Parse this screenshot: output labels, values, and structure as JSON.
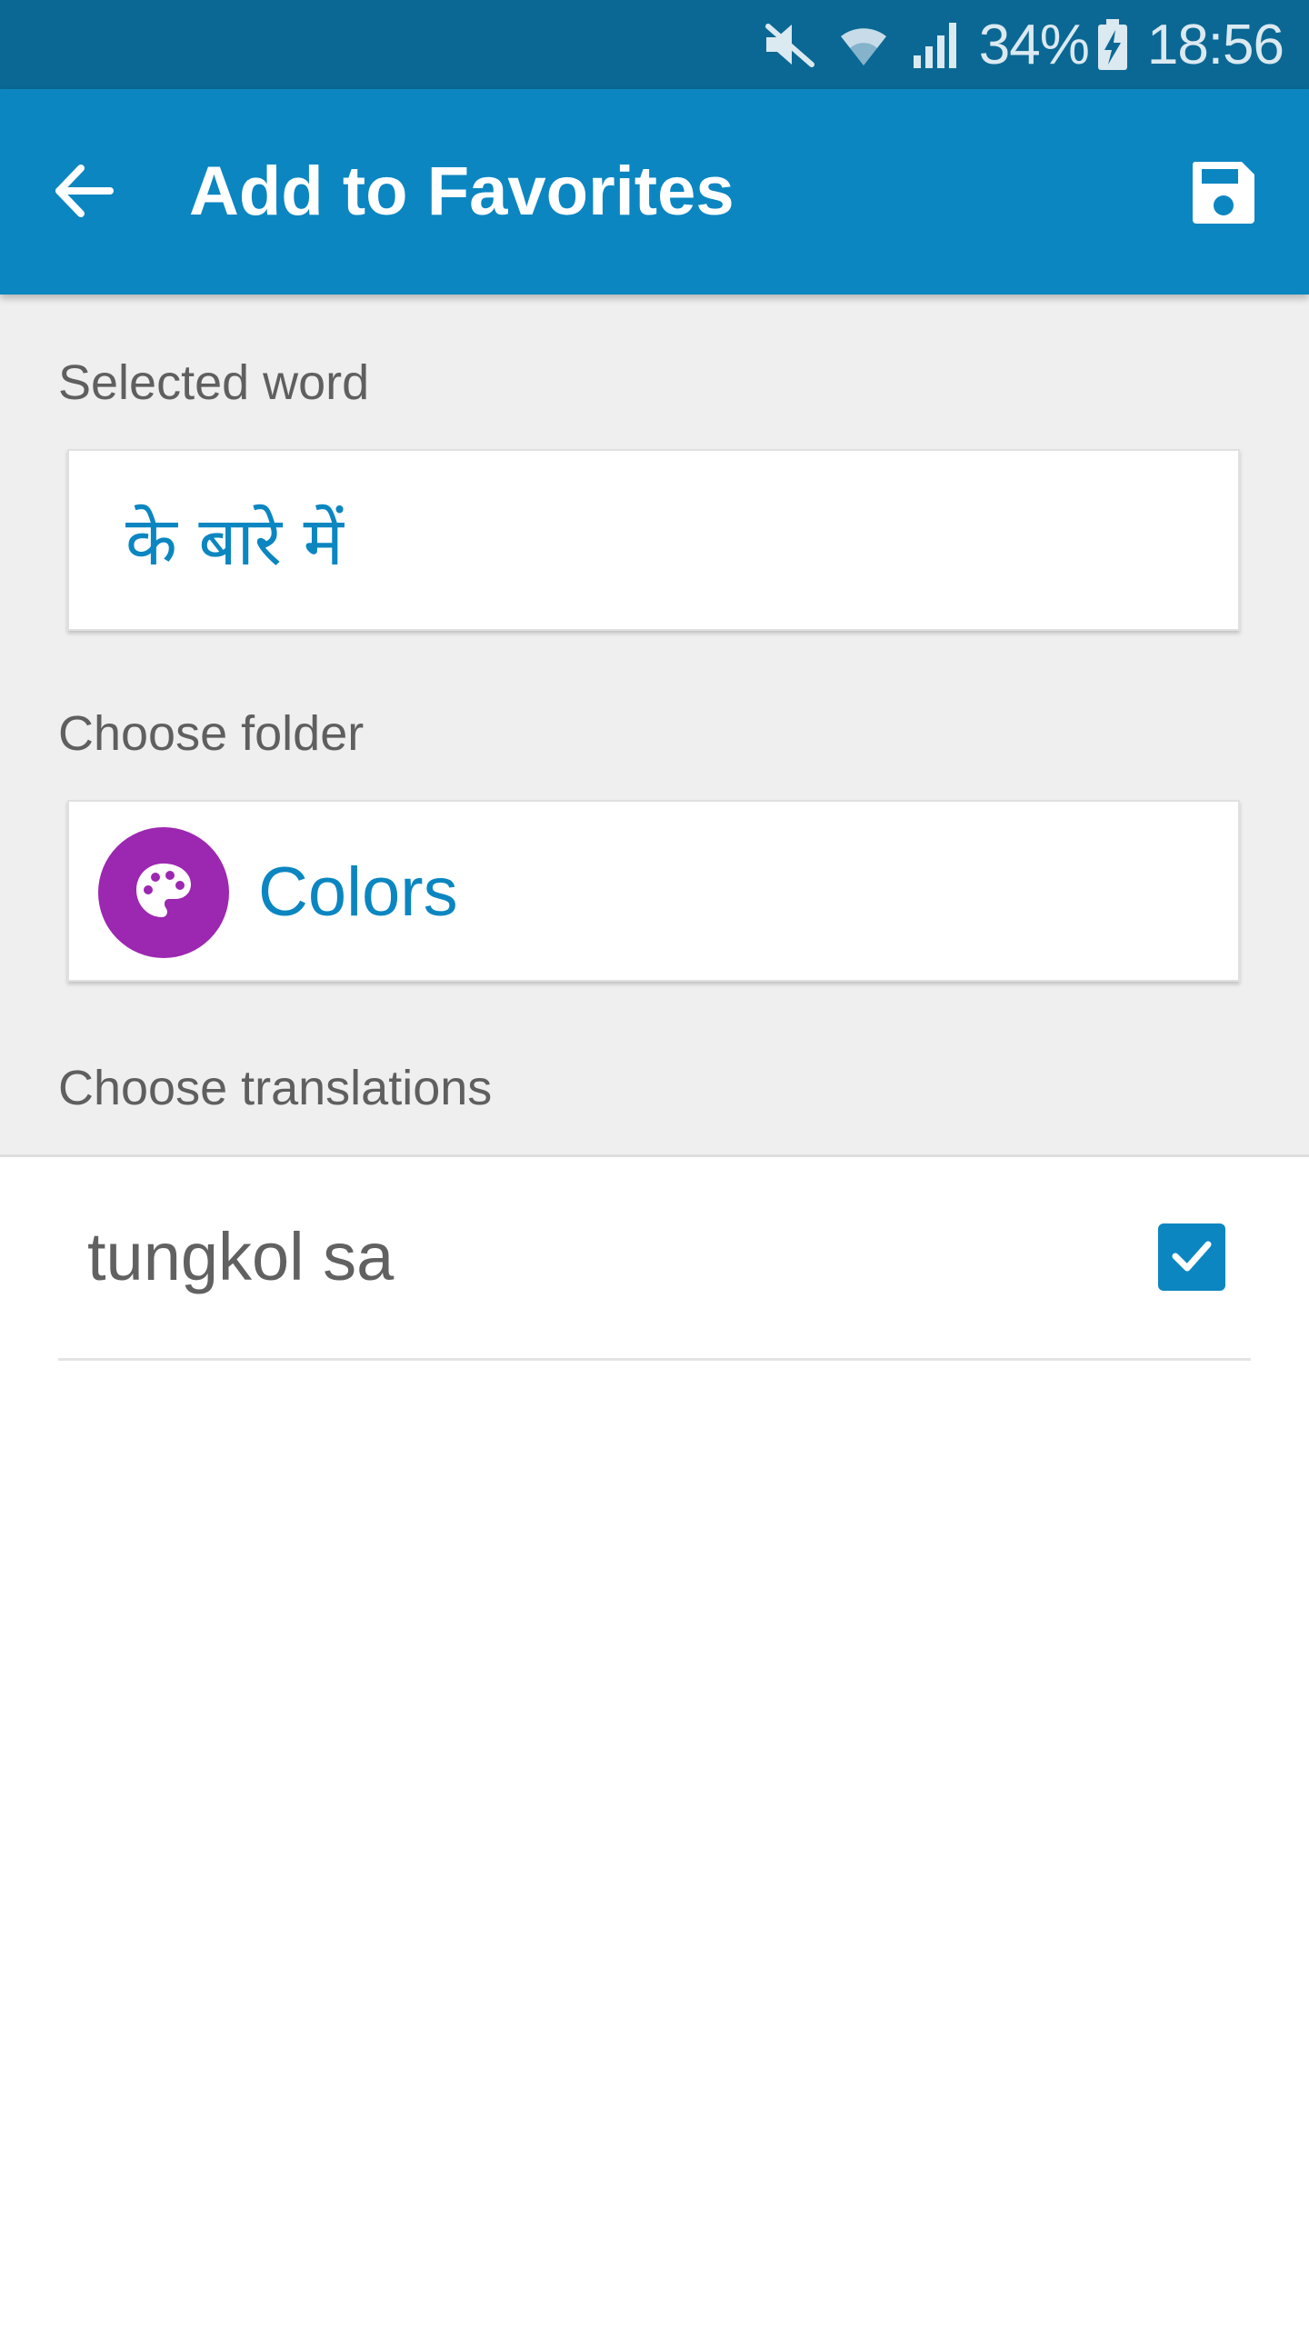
{
  "status_bar": {
    "battery": "34%",
    "time": "18:56",
    "icons": [
      "mute-icon",
      "wifi-icon",
      "signal-icon",
      "battery-charging-icon"
    ]
  },
  "app_bar": {
    "title": "Add to Favorites",
    "back_icon": "arrow-back-icon",
    "save_icon": "save-icon",
    "background": "#0b86c1"
  },
  "form": {
    "selected_word_label": "Selected word",
    "selected_word": "के बारे में",
    "folder_label": "Choose folder",
    "folder": {
      "name": "Colors",
      "icon": "palette-icon",
      "icon_color": "#9c27b0"
    },
    "translations_label": "Choose translations"
  },
  "translations": [
    {
      "text": "tungkol sa",
      "checked": true
    }
  ],
  "colors": {
    "status_bar": "#0b6894",
    "accent": "#0b86c1",
    "form_background": "#efefef"
  }
}
